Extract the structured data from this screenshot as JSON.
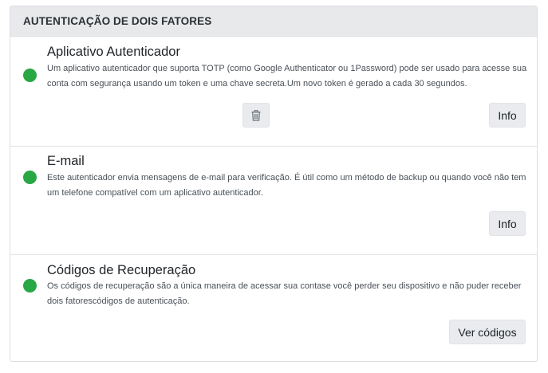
{
  "header": {
    "title": "AUTENTICAÇÃO DE DOIS FATORES"
  },
  "methods": [
    {
      "title": "Aplicativo Autenticador",
      "description": "Um aplicativo autenticador que suporta TOTP (como Google Authenticator ou 1Password) pode ser usado para acesse sua conta com segurança usando um token e uma chave secreta.Um novo token é gerado a cada 30 segundos.",
      "status": "enabled",
      "status_icon": "status-dot-green",
      "delete_icon": "trash-icon",
      "info_label": "Info"
    },
    {
      "title": "E-mail",
      "description": "Este autenticador envia mensagens de e-mail para verificação. É útil como um método de backup ou quando você não tem um telefone compatível com um aplicativo autenticador.",
      "status": "enabled",
      "status_icon": "status-dot-green",
      "info_label": "Info"
    },
    {
      "title": "Códigos de Recuperação",
      "description": "Os códigos de recuperação são a única maneira de acessar sua contase você perder seu dispositivo e não puder receber dois fatorescódigos de autenticação.",
      "status": "enabled",
      "status_icon": "status-dot-green",
      "view_codes_label": "Ver códigos"
    }
  ],
  "colors": {
    "status_enabled": "#28a745",
    "header_bg": "#e8e9eb",
    "button_bg": "#e9ebee"
  }
}
